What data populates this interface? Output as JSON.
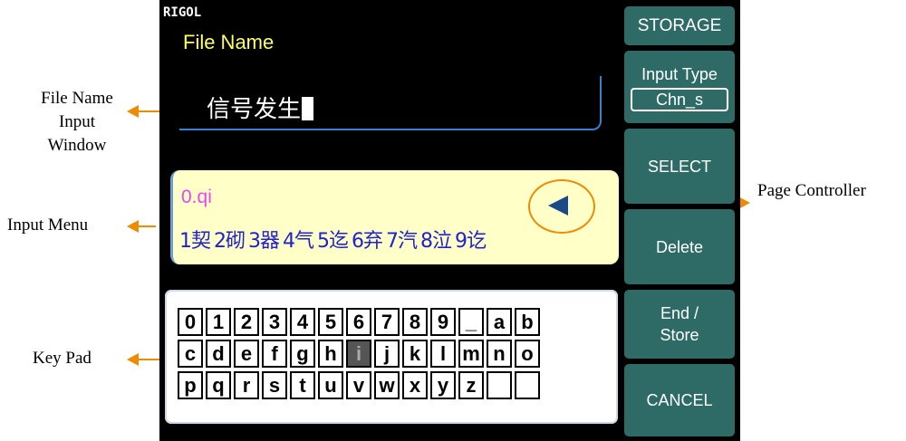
{
  "annotations": {
    "file_name_window": "File Name\nInput\nWindow",
    "input_menu": "Input Menu",
    "key_pad": "Key Pad",
    "page_controller": "Page Controller"
  },
  "screen": {
    "brand": "RIGOL",
    "file_name_label": "File Name",
    "input_value": "信号发生",
    "pinyin": "0.qi",
    "candidates": [
      "1契",
      "2砌",
      "3器",
      "4气",
      "5迄",
      "6弃",
      "7汽",
      "8泣",
      "9讫"
    ],
    "keypad_rows": [
      [
        "0",
        "1",
        "2",
        "3",
        "4",
        "5",
        "6",
        "7",
        "8",
        "9",
        "_",
        "a",
        "b"
      ],
      [
        "c",
        "d",
        "e",
        "f",
        "g",
        "h",
        "i",
        "j",
        "k",
        "l",
        "m",
        "n",
        "o"
      ],
      [
        "p",
        "q",
        "r",
        "s",
        "t",
        "u",
        "v",
        "w",
        "x",
        "y",
        "z",
        " ",
        " "
      ]
    ],
    "selected_key": "i"
  },
  "side_menu": {
    "title": "STORAGE",
    "input_type_label": "Input Type",
    "input_type_value": "Chn_s",
    "select": "SELECT",
    "delete": "Delete",
    "end_store": "End /\nStore",
    "cancel": "CANCEL"
  },
  "colors": {
    "accent": "#f08a00",
    "softkey": "#2f6b66",
    "menu_bg": "#ffffc8",
    "candidate_text": "#2222cc",
    "pinyin_text": "#ee44ee",
    "title_text": "#ffff66"
  },
  "icons": [
    "page-left-arrow-icon"
  ]
}
